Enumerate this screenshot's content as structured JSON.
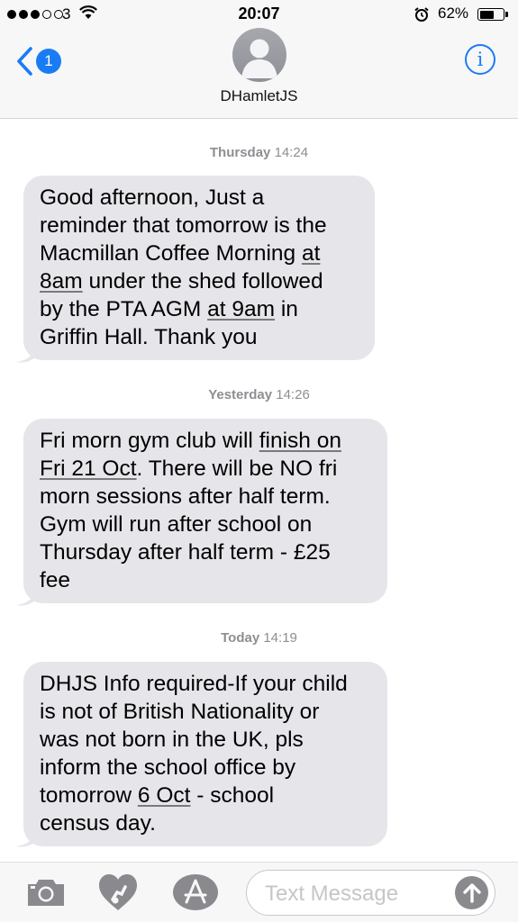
{
  "status_bar": {
    "carrier": "3",
    "time": "20:07",
    "battery_percent": "62%",
    "signal_bars_filled": 3,
    "signal_bars_total": 5,
    "battery_level": 0.62
  },
  "nav": {
    "back_badge": "1",
    "contact_name": "DHamletJS",
    "info_label": "i"
  },
  "messages": [
    {
      "day": "Thursday",
      "time": "14:24",
      "lines": [
        "Good afternoon, Just a",
        "reminder that tomorrow is the",
        "Macmillan Coffee Morning at",
        "8am under the shed followed",
        "by the PTA AGM at 9am in",
        "Griffin Hall. Thank you"
      ]
    },
    {
      "day": "Yesterday",
      "time": "14:26",
      "lines": [
        "Fri morn gym club will finish on",
        "Fri 21 Oct. There will be NO fri",
        "morn sessions after half term.",
        "Gym will run after school on",
        "Thursday after half term - £25",
        "fee"
      ]
    },
    {
      "day": "Today",
      "time": "14:19",
      "lines": [
        "DHJS Info required-If your child",
        "is not of British Nationality or",
        "was not born in the UK, pls",
        "inform the school office by",
        "tomorrow 6 Oct - school",
        "census day."
      ]
    }
  ],
  "composer": {
    "placeholder": "Text Message"
  },
  "colors": {
    "accent": "#1a7cf5",
    "bubble": "#e5e5ea",
    "timestamp": "#8e8e93",
    "bar_bg": "#f7f7f8"
  },
  "icons": [
    "back-chevron-icon",
    "contact-avatar-icon",
    "info-icon",
    "camera-icon",
    "digital-touch-icon",
    "app-store-icon",
    "send-arrow-icon",
    "wifi-icon",
    "alarm-icon",
    "battery-icon"
  ]
}
